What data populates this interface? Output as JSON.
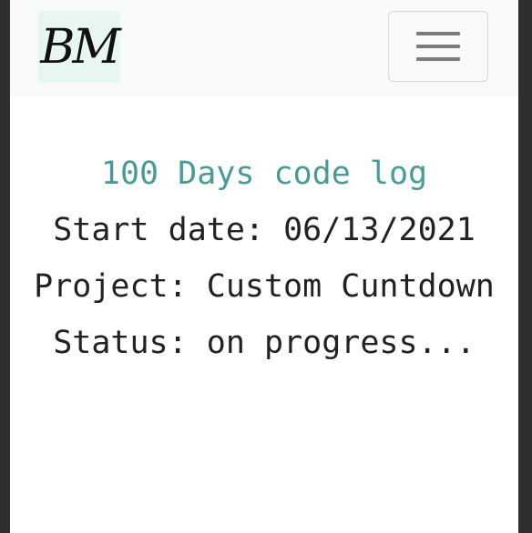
{
  "navbar": {
    "brand_text": "BM",
    "toggler_icon": "hamburger-icon"
  },
  "content": {
    "title": "100 Days code log",
    "start_date": "Start date: 06/13/2021",
    "project": "Project: Custom Cuntdown",
    "status": "Status: on progress..."
  },
  "colors": {
    "accent": "#4a9b98",
    "brand_bg": "#e8f6f2",
    "navbar_bg": "#f8f9fa",
    "text": "#222222"
  }
}
